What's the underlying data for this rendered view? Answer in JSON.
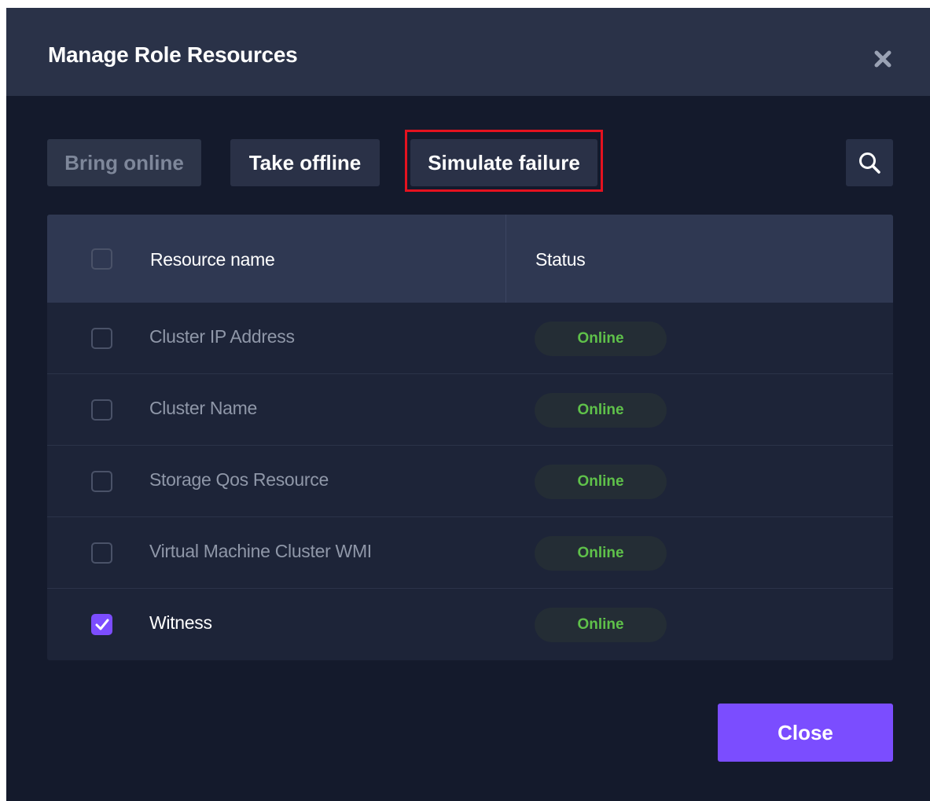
{
  "dialog": {
    "title": "Manage Role Resources",
    "close_icon": "close-x-icon"
  },
  "toolbar": {
    "bring_online_label": "Bring online",
    "take_offline_label": "Take offline",
    "simulate_failure_label": "Simulate failure",
    "search_icon": "search-icon"
  },
  "table": {
    "columns": [
      "Resource name",
      "Status"
    ],
    "rows": [
      {
        "name": "Cluster IP Address",
        "status": "Online",
        "checked": false
      },
      {
        "name": "Cluster Name",
        "status": "Online",
        "checked": false
      },
      {
        "name": "Storage Qos Resource",
        "status": "Online",
        "checked": false
      },
      {
        "name": "Virtual Machine Cluster WMI",
        "status": "Online",
        "checked": false
      },
      {
        "name": "Witness",
        "status": "Online",
        "checked": true
      }
    ]
  },
  "footer": {
    "close_label": "Close"
  },
  "colors": {
    "accent": "#7b4dff",
    "status_online": "#5fc14a",
    "highlight_border": "#e4121f",
    "dialog_bg": "#141a2c"
  }
}
